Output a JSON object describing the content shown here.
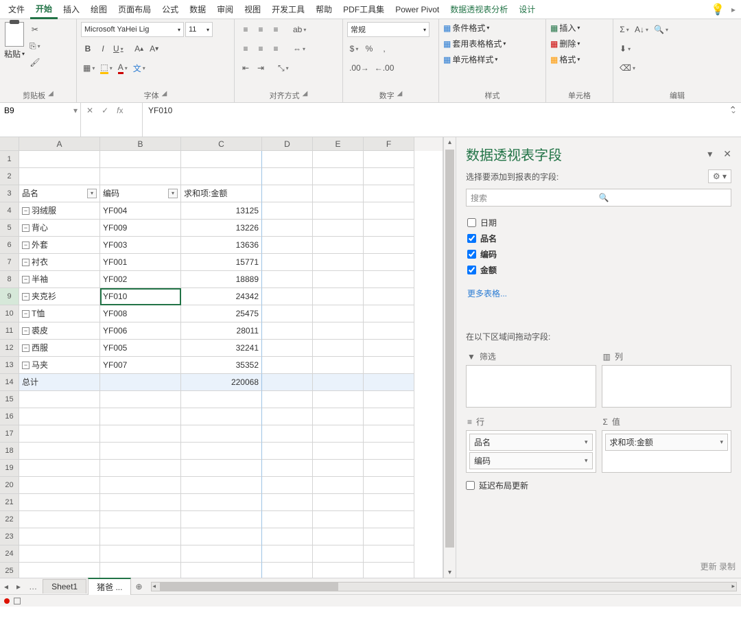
{
  "menu": {
    "tabs": [
      "文件",
      "开始",
      "插入",
      "绘图",
      "页面布局",
      "公式",
      "数据",
      "审阅",
      "视图",
      "开发工具",
      "帮助",
      "PDF工具集",
      "Power Pivot",
      "数据透视表分析",
      "设计"
    ],
    "active_index": 1,
    "green_indices": [
      13,
      14
    ]
  },
  "ribbon": {
    "clipboard": {
      "label": "剪贴板",
      "paste": "粘贴"
    },
    "font": {
      "label": "字体",
      "name": "Microsoft YaHei Lig",
      "size": "11",
      "bold": "B",
      "italic": "I",
      "underline": "U"
    },
    "alignment": {
      "label": "对齐方式",
      "wrap": "ab"
    },
    "number": {
      "label": "数字",
      "format": "常规"
    },
    "styles": {
      "label": "样式",
      "cond": "条件格式",
      "tablefmt": "套用表格格式",
      "cellstyle": "单元格样式"
    },
    "cells": {
      "label": "单元格",
      "insert": "插入",
      "delete": "删除",
      "format": "格式"
    },
    "editing": {
      "label": "编辑"
    }
  },
  "namebox": "B9",
  "formula": "YF010",
  "grid": {
    "cols": [
      "A",
      "B",
      "C",
      "D",
      "E",
      "F"
    ],
    "headers": {
      "A": "品名",
      "B": "编码",
      "C": "求和项:金额"
    },
    "rows": [
      {
        "n": 1
      },
      {
        "n": 2
      },
      {
        "n": 3,
        "header": true
      },
      {
        "n": 4,
        "A": "羽绒服",
        "B": "YF004",
        "C": "13125"
      },
      {
        "n": 5,
        "A": "背心",
        "B": "YF009",
        "C": "13226"
      },
      {
        "n": 6,
        "A": "外套",
        "B": "YF003",
        "C": "13636"
      },
      {
        "n": 7,
        "A": "衬衣",
        "B": "YF001",
        "C": "15771"
      },
      {
        "n": 8,
        "A": "半袖",
        "B": "YF002",
        "C": "18889"
      },
      {
        "n": 9,
        "A": "夹克衫",
        "B": "YF010",
        "C": "24342",
        "selected": true
      },
      {
        "n": 10,
        "A": "T恤",
        "B": "YF008",
        "C": "25475"
      },
      {
        "n": 11,
        "A": "裘皮",
        "B": "YF006",
        "C": "28011"
      },
      {
        "n": 12,
        "A": "西服",
        "B": "YF005",
        "C": "32241"
      },
      {
        "n": 13,
        "A": "马夹",
        "B": "YF007",
        "C": "35352"
      },
      {
        "n": 14,
        "total": true,
        "A": "总计",
        "C": "220068"
      },
      {
        "n": 15
      },
      {
        "n": 16
      },
      {
        "n": 17
      },
      {
        "n": 18
      },
      {
        "n": 19
      },
      {
        "n": 20
      },
      {
        "n": 21
      },
      {
        "n": 22
      },
      {
        "n": 23
      },
      {
        "n": 24
      },
      {
        "n": 25
      }
    ]
  },
  "pane": {
    "title": "数据透视表字段",
    "choose": "选择要添加到报表的字段:",
    "search": "搜索",
    "fields": [
      {
        "label": "日期",
        "checked": false
      },
      {
        "label": "品名",
        "checked": true
      },
      {
        "label": "编码",
        "checked": true
      },
      {
        "label": "金额",
        "checked": true
      }
    ],
    "more": "更多表格...",
    "drag": "在以下区域间拖动字段:",
    "zones": {
      "filter": "筛选",
      "columns": "列",
      "rows": "行",
      "values": "值",
      "row_chips": [
        "品名",
        "编码"
      ],
      "value_chips": [
        "求和项:金额"
      ]
    },
    "defer": "延迟布局更新",
    "update": "更新\n录制"
  },
  "tabs": {
    "sheet1": "Sheet1",
    "sheet2": "猪爸 ..."
  }
}
